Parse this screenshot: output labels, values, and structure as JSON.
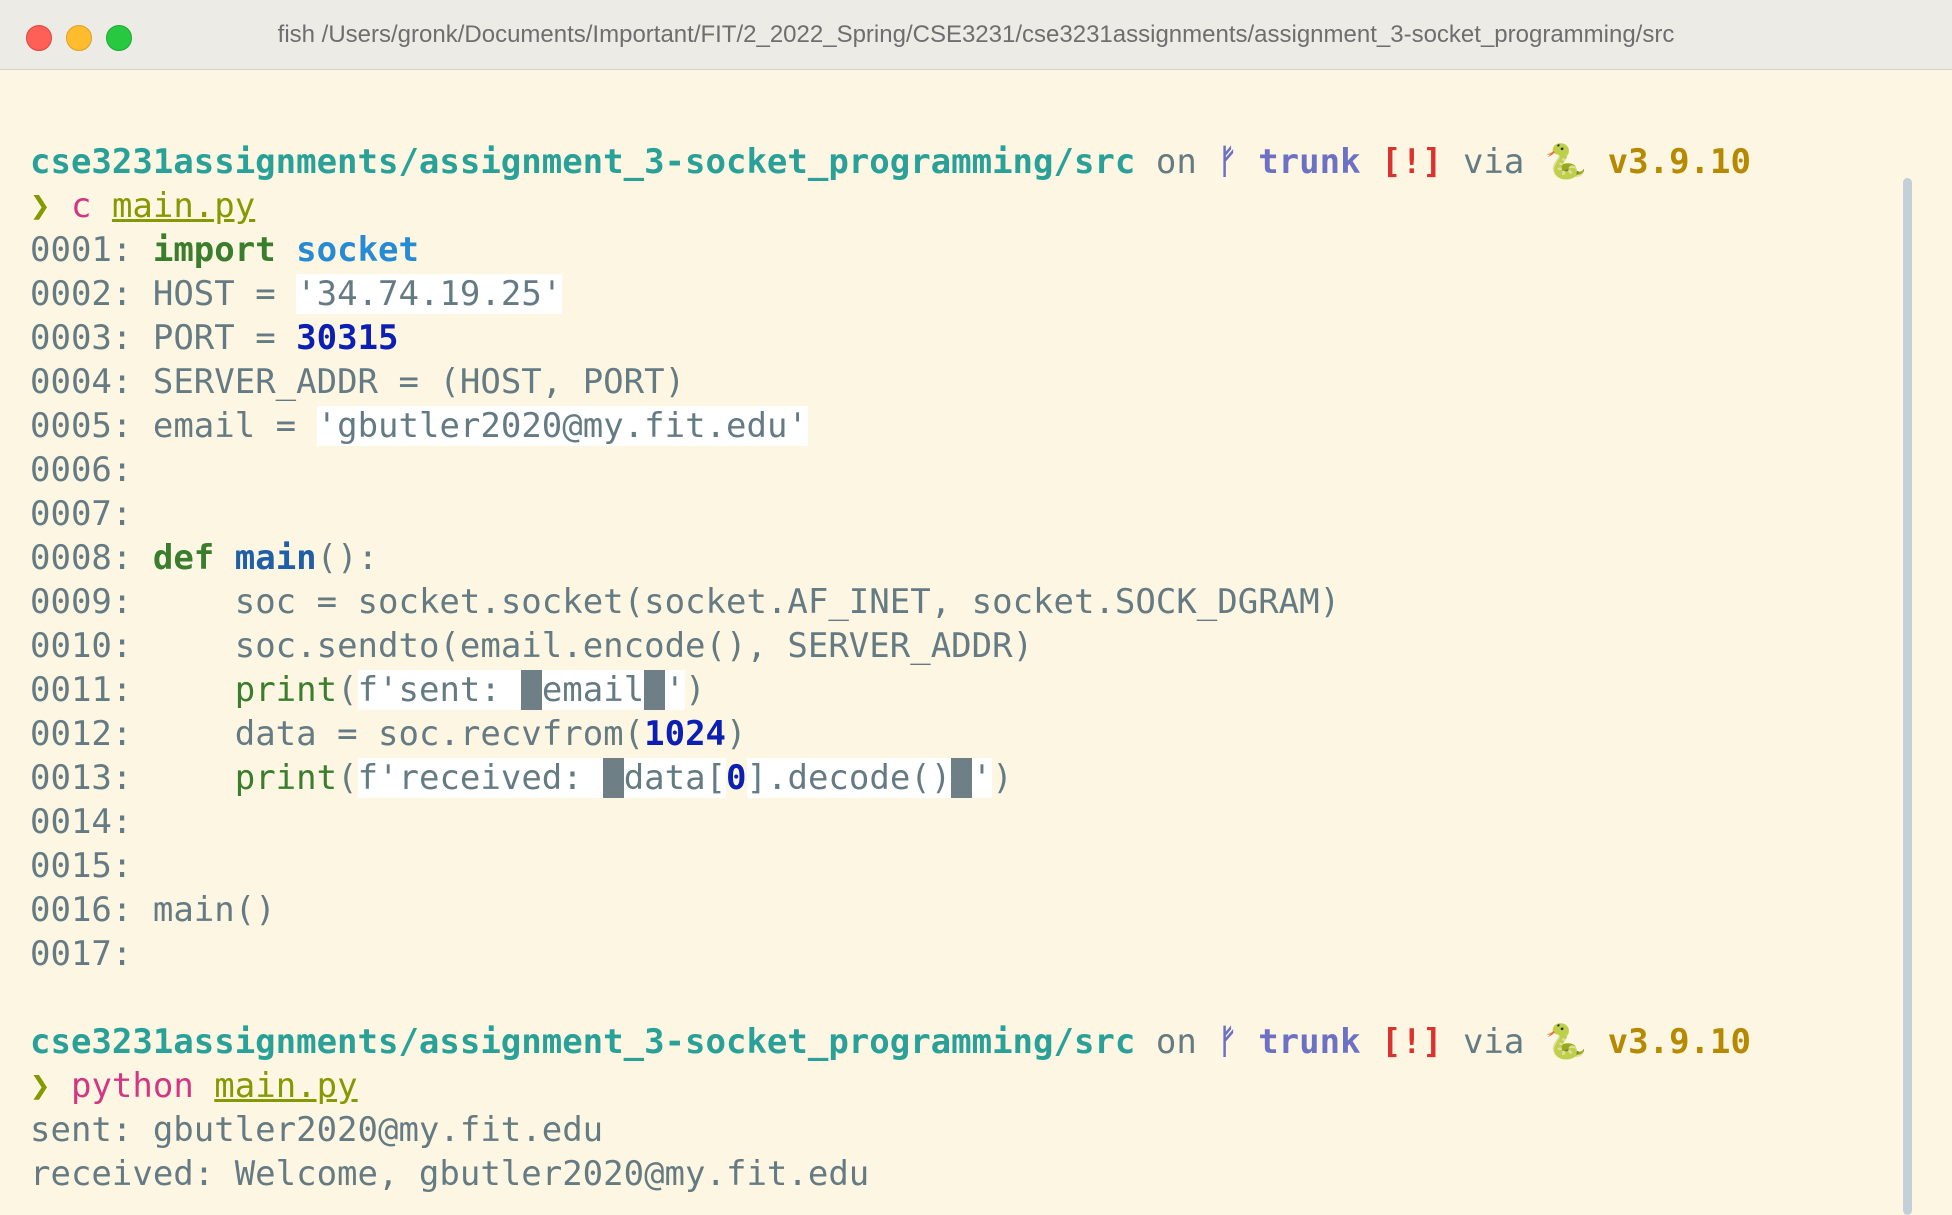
{
  "window": {
    "title": "fish /Users/gronk/Documents/Important/FIT/2_2022_Spring/CSE3231/cse3231assignments/assignment_3-socket_programming/src"
  },
  "prompt": {
    "path": "cse3231assignments/assignment_3-socket_programming/src",
    "on": "on",
    "branch_icon": "git-branch-icon",
    "branch_glyph": "ᚠ",
    "branch": "trunk",
    "status": "[!]",
    "via": "via",
    "python_icon": "snake-icon",
    "python_glyph": "🐍",
    "version": "v3.9.10",
    "arrow": "❯"
  },
  "command1": {
    "cmd": "c",
    "arg": "main.py"
  },
  "code": {
    "ln": [
      "0001:",
      "0002:",
      "0003:",
      "0004:",
      "0005:",
      "0006:",
      "0007:",
      "0008:",
      "0009:",
      "0010:",
      "0011:",
      "0012:",
      "0013:",
      "0014:",
      "0015:",
      "0016:",
      "0017:"
    ],
    "l1": {
      "kw": "import",
      "mod": "socket"
    },
    "l2": {
      "name": "HOST",
      "op": " = ",
      "str": "'34.74.19.25'"
    },
    "l3": {
      "name": "PORT",
      "op": " = ",
      "num": "30315"
    },
    "l4": {
      "text": "SERVER_ADDR = (HOST, PORT)"
    },
    "l5": {
      "name": "email",
      "op": " = ",
      "str": "'gbutler2020@my.fit.edu'"
    },
    "l8": {
      "kw": "def",
      "fn": "main",
      "rest": "():"
    },
    "l9": {
      "text": "soc = socket.socket(socket.AF_INET, socket.SOCK_DGRAM)"
    },
    "l10": {
      "text": "soc.sendto(email.encode(), SERVER_ADDR)"
    },
    "l11": {
      "fn": "print",
      "open": "(",
      "s1": "f'sent: ",
      "b1": "{",
      "expr": "email",
      "b2": "}",
      "s2": "'",
      "close": ")"
    },
    "l12": {
      "pre": "data = soc.recvfrom(",
      "num": "1024",
      "close": ")"
    },
    "l13": {
      "fn": "print",
      "open": "(",
      "s1": "f'received: ",
      "b1": "{",
      "expr1": "data[",
      "num": "0",
      "expr2": "].decode()",
      "b2": "}",
      "s2": "'",
      "close": ")"
    },
    "l16": {
      "text": "main()"
    }
  },
  "command2": {
    "cmd": "python",
    "arg": "main.py"
  },
  "output": [
    "sent: gbutler2020@my.fit.edu",
    "received: Welcome, gbutler2020@my.fit.edu"
  ]
}
